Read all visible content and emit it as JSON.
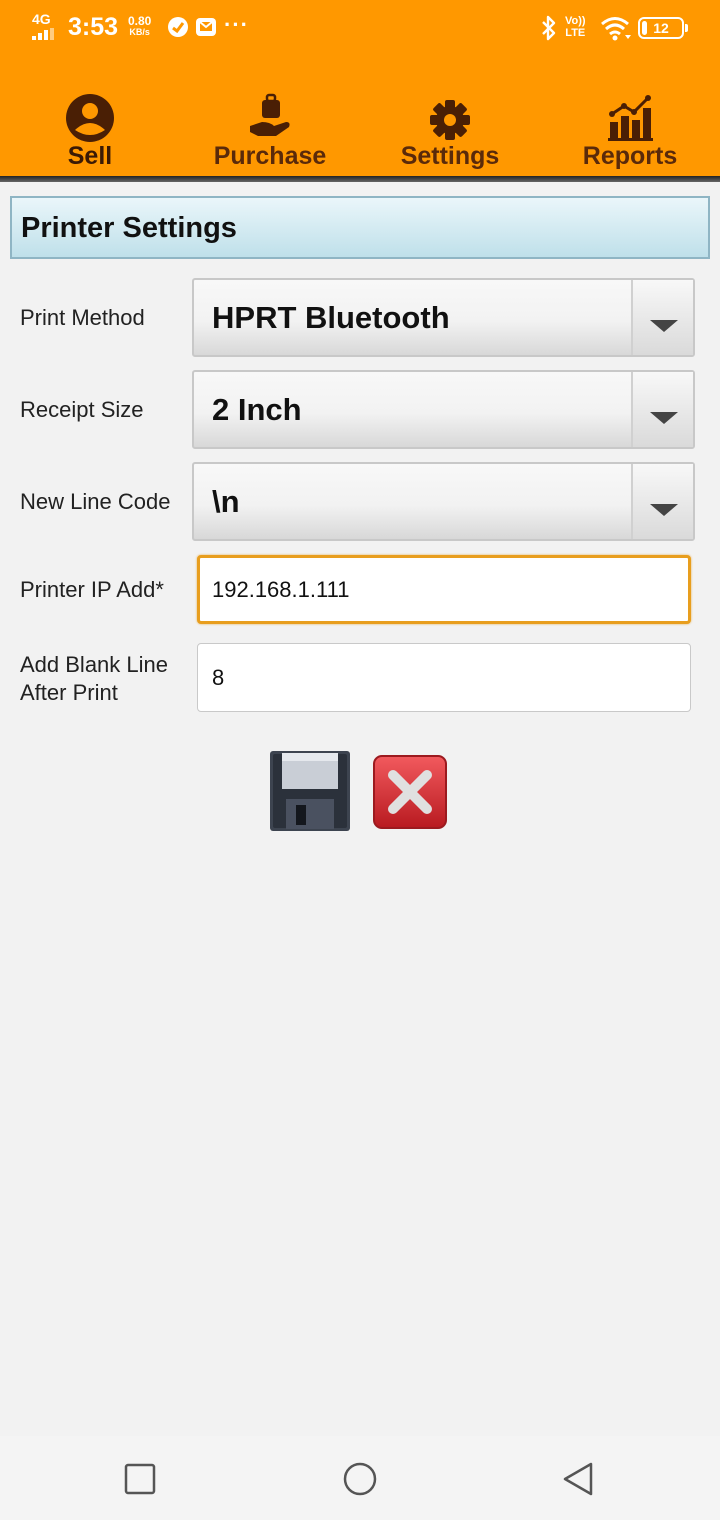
{
  "status_bar": {
    "network": "4G",
    "time": "3:53",
    "speed_value": "0.80",
    "speed_unit": "KB/s",
    "dots": "···",
    "volte_top": "Vo))",
    "volte_bottom": "LTE",
    "battery": "12",
    "battery_level": 0.12
  },
  "nav": {
    "items": [
      {
        "label": "Sell",
        "icon": "person-circle-icon"
      },
      {
        "label": "Purchase",
        "icon": "hand-bag-icon"
      },
      {
        "label": "Settings",
        "icon": "gear-icon"
      },
      {
        "label": "Reports",
        "icon": "bar-chart-icon"
      }
    ]
  },
  "section": {
    "title": "Printer Settings"
  },
  "form": {
    "print_method": {
      "label": "Print Method",
      "value": "HPRT Bluetooth"
    },
    "receipt_size": {
      "label": "Receipt Size",
      "value": "2 Inch"
    },
    "new_line_code": {
      "label": "New Line Code",
      "value": "\\n"
    },
    "printer_ip": {
      "label": "Printer IP Add*",
      "value": "192.168.1.111"
    },
    "blank_lines": {
      "label_line1": "Add Blank Line",
      "label_line2": "After Print",
      "value": "8"
    }
  },
  "actions": {
    "save_icon": "floppy-disk-icon",
    "cancel_icon": "red-x-icon"
  },
  "colors": {
    "header_orange": "#ff9800",
    "nav_text": "#5a2a0a",
    "focus_border": "#e89e1e",
    "cancel_red": "#d9262b"
  },
  "system_nav": [
    "recent-apps-icon",
    "home-icon",
    "back-icon"
  ]
}
